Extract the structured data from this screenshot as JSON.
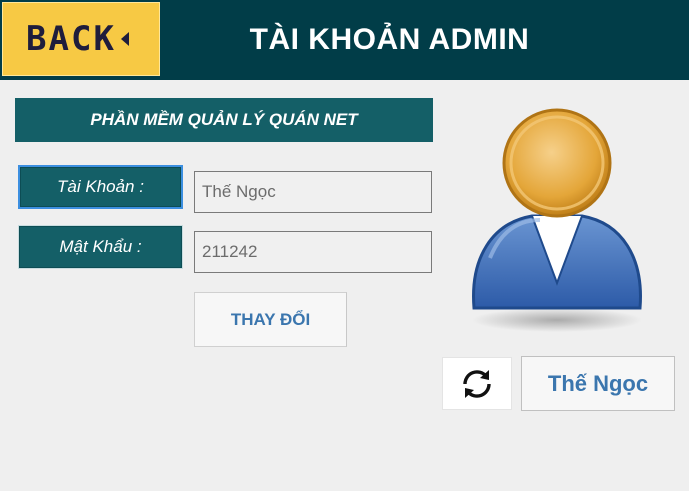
{
  "header": {
    "back_label": "BACK",
    "title": "TÀI KHOẢN ADMIN"
  },
  "form": {
    "subtitle": "PHẦN MỀM QUẢN LÝ QUÁN NET",
    "account_label": "Tài Khoản :",
    "account_value": "Thế Ngọc",
    "password_label": "Mật Khẩu :",
    "password_value": "211242",
    "change_button": "THAY ĐỔI"
  },
  "profile": {
    "refresh_icon": "refresh-icon",
    "avatar_icon": "user-avatar-icon",
    "user_name": "Thế Ngọc"
  },
  "colors": {
    "header_bg": "#013d48",
    "back_bg": "#f7c944",
    "label_bg": "#145f67",
    "accent_text": "#3b76ae"
  }
}
